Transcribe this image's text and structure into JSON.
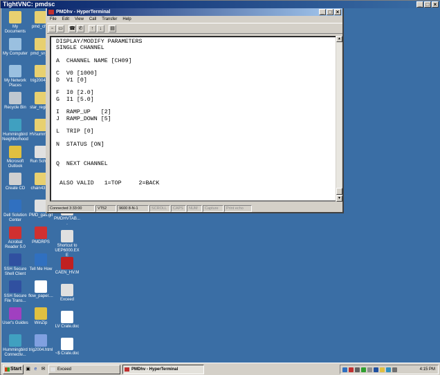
{
  "vnc": {
    "title": "TightVNC: pmdsc"
  },
  "desktop_icons_col1": [
    {
      "label": "My Documents",
      "icon": "my-documents-icon",
      "color": "#e8d070"
    },
    {
      "label": "My Computer",
      "icon": "my-computer-icon",
      "color": "#9ac0e0"
    },
    {
      "label": "My Network Places",
      "icon": "network-places-icon",
      "color": "#9ac0e0"
    },
    {
      "label": "Recycle Bin",
      "icon": "recycle-bin-icon",
      "color": "#c0c8d0"
    },
    {
      "label": "Hummingbird Neighborhood",
      "icon": "hummingbird-icon",
      "color": "#40a0c0"
    },
    {
      "label": "Microsoft Outlook",
      "icon": "outlook-icon",
      "color": "#e0c040"
    },
    {
      "label": "Create CD",
      "icon": "create-cd-icon",
      "color": "#d0d0d0"
    },
    {
      "label": "Dell Solution Center",
      "icon": "dell-icon",
      "color": "#3070c0"
    },
    {
      "label": "Acrobat Reader 5.0",
      "icon": "acrobat-icon",
      "color": "#d03030"
    },
    {
      "label": "SSH Secure Shell Client",
      "icon": "ssh-client-icon",
      "color": "#3050a0"
    },
    {
      "label": "SSH Secure File Trans...",
      "icon": "ssh-file-transfer-icon",
      "color": "#3050a0"
    },
    {
      "label": "User's Guides",
      "icon": "user-guides-icon",
      "color": "#a040c0"
    },
    {
      "label": "Hummingbird Connectiv...",
      "icon": "hummingbird-connectivity-icon",
      "color": "#40a0c0"
    }
  ],
  "desktop_icons_col2": [
    {
      "label": "pmd_ch...",
      "icon": "folder-icon",
      "color": "#e8d070"
    },
    {
      "label": "pmd_sn_...",
      "icon": "folder-icon",
      "color": "#e8d070"
    },
    {
      "label": "trig2004_...",
      "icon": "folder-icon",
      "color": "#e8d070"
    },
    {
      "label": "star_regio...",
      "icon": "folder-icon",
      "color": "#e8d070"
    },
    {
      "label": "HVsumma...",
      "icon": "folder-icon",
      "color": "#e8d070"
    },
    {
      "label": "Run Scho...",
      "icon": "run-schedule-icon",
      "color": "#e0e0e0"
    },
    {
      "label": "chain43.j...",
      "icon": "document-icon",
      "color": "#e8d070"
    },
    {
      "label": "PMD_gas.gif",
      "icon": "gif-file-icon",
      "color": "#e0e0e0"
    },
    {
      "label": "PMDRPS",
      "icon": "pmdrps-icon",
      "color": "#d03030"
    },
    {
      "label": "Tell Me How",
      "icon": "tell-me-how-icon",
      "color": "#3070c0"
    },
    {
      "label": "flow_paper....",
      "icon": "word-doc-icon",
      "color": "#ffffff"
    },
    {
      "label": "WinZip",
      "icon": "winzip-icon",
      "color": "#e0c040"
    },
    {
      "label": "trig2004.html",
      "icon": "html-file-icon",
      "color": "#80a0e0"
    }
  ],
  "desktop_icons_col3": [
    {
      "label": "PMDHVTAB....",
      "icon": "pmdhvtab-icon",
      "color": "#e0e0e0"
    },
    {
      "label": "Shortcut to UEP6000.EXE",
      "icon": "shortcut-icon",
      "color": "#e0e0e0"
    },
    {
      "label": "CAEN_HV.M",
      "icon": "caen-hv-icon",
      "color": "#c02020"
    },
    {
      "label": "Exceed",
      "icon": "exceed-icon",
      "color": "#e0e0e0"
    },
    {
      "label": "LV Crate.doc",
      "icon": "word-doc-icon",
      "color": "#ffffff"
    },
    {
      "label": "~$ Crate.doc",
      "icon": "word-doc-icon",
      "color": "#ffffff"
    }
  ],
  "hyperterminal": {
    "title": "PMDhv - HyperTerminal",
    "menus": [
      "File",
      "Edit",
      "View",
      "Call",
      "Transfer",
      "Help"
    ],
    "terminal_lines": [
      "DISPLAY/MODIFY PARAMETERS",
      "SINGLE CHANNEL",
      "",
      "A  CHANNEL NAME [CH09]",
      "",
      "C  V0 [1000]",
      "D  V1 [0]",
      "",
      "F  I0 [2.0]",
      "G  I1 [5.0]",
      "",
      "I  RAMP_UP   [2]",
      "J  RAMP_DOWN [5]",
      "",
      "L  TRIP [0]",
      "",
      "N  STATUS [ON]",
      "",
      "",
      "Q  NEXT CHANNEL",
      "",
      "",
      " ALSO VALID   1=TOP     2=BACK"
    ],
    "status": [
      {
        "text": "Connected 3:33:00",
        "dim": false
      },
      {
        "text": "VT52",
        "dim": false
      },
      {
        "text": "9600 8-N-1",
        "dim": false
      },
      {
        "text": "SCROLL",
        "dim": true
      },
      {
        "text": "CAPS",
        "dim": true
      },
      {
        "text": "NUM",
        "dim": true
      },
      {
        "text": "Capture",
        "dim": true
      },
      {
        "text": "Print echo",
        "dim": true
      }
    ]
  },
  "taskbar": {
    "start_label": "Start",
    "tasks": [
      {
        "label": "Exceed",
        "active": false
      },
      {
        "label": "PMDhv - HyperTerminal",
        "active": true
      }
    ],
    "clock": "4:15 PM"
  }
}
